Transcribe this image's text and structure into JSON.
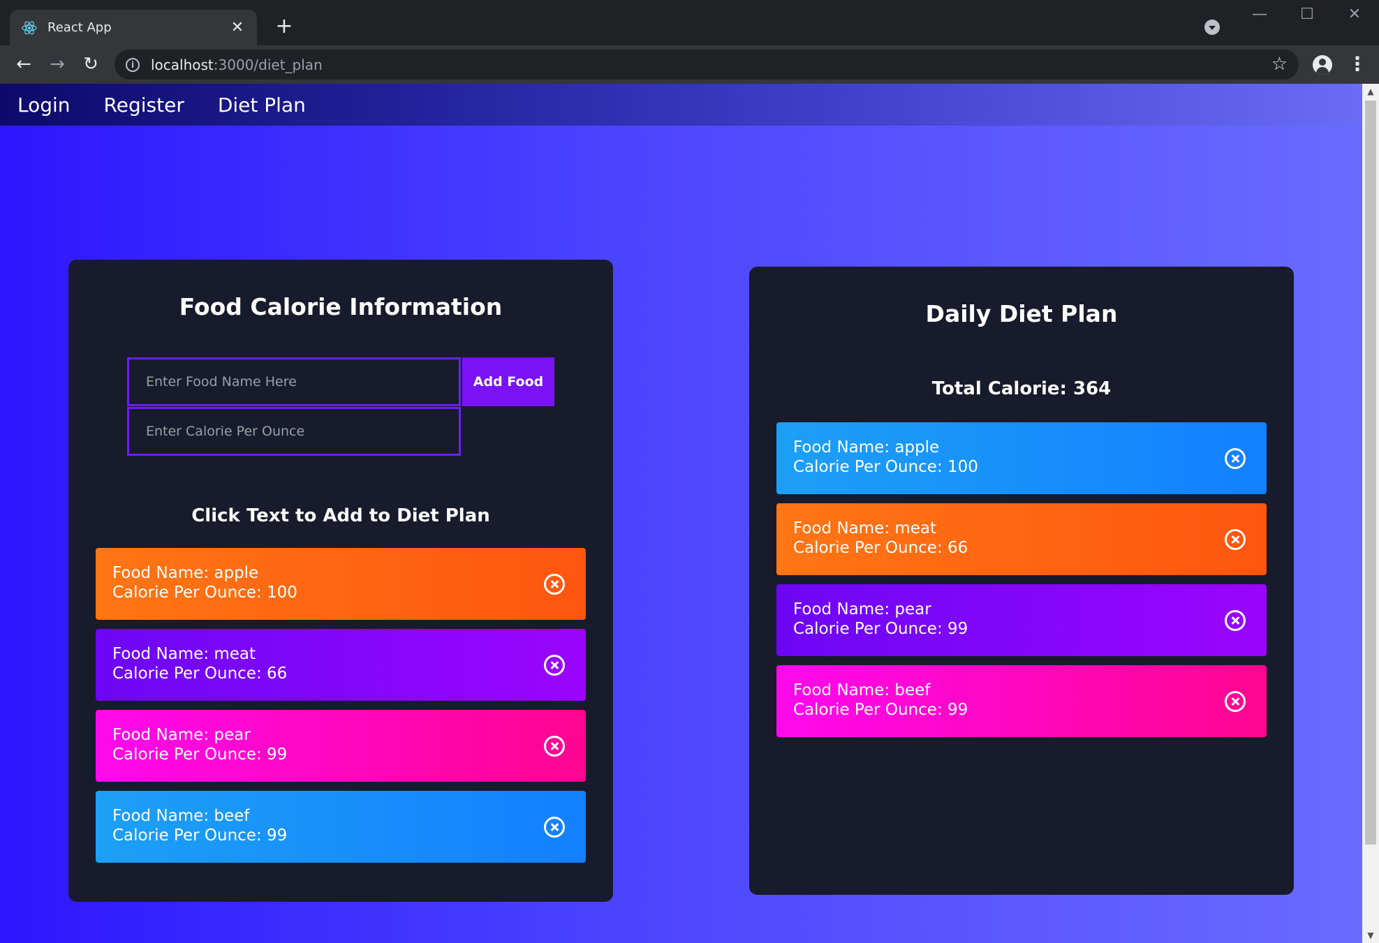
{
  "browser": {
    "tab_title": "React App",
    "tab_close": "✕",
    "new_tab": "+",
    "url_host": "localhost",
    "url_rest": ":3000/diet_plan",
    "win_min": "—",
    "win_max": "☐",
    "win_close": "✕",
    "back": "←",
    "forward": "→",
    "reload": "↻",
    "star": "☆",
    "menu": "⋮"
  },
  "navbar": {
    "links": [
      "Login",
      "Register",
      "Diet Plan"
    ]
  },
  "food_info": {
    "title": "Food Calorie Information",
    "food_name_placeholder": "Enter Food Name Here",
    "calorie_placeholder": "Enter Calorie Per Ounce",
    "add_button": "Add Food",
    "subheading": "Click Text to Add to Diet Plan",
    "items": [
      {
        "name": "Food Name: apple",
        "calorie": "Calorie Per Ounce: 100",
        "color": "orange"
      },
      {
        "name": "Food Name: meat",
        "calorie": "Calorie Per Ounce: 66",
        "color": "purple"
      },
      {
        "name": "Food Name: pear",
        "calorie": "Calorie Per Ounce: 99",
        "color": "pink"
      },
      {
        "name": "Food Name: beef",
        "calorie": "Calorie Per Ounce: 99",
        "color": "blue"
      }
    ]
  },
  "diet_plan": {
    "title": "Daily Diet Plan",
    "total": "Total Calorie: 364",
    "items": [
      {
        "name": "Food Name: apple",
        "calorie": "Calorie Per Ounce: 100",
        "color": "blue"
      },
      {
        "name": "Food Name: meat",
        "calorie": "Calorie Per Ounce: 66",
        "color": "orange"
      },
      {
        "name": "Food Name: pear",
        "calorie": "Calorie Per Ounce: 99",
        "color": "purple"
      },
      {
        "name": "Food Name: beef",
        "calorie": "Calorie Per Ounce: 99",
        "color": "pink"
      }
    ]
  },
  "colors": {
    "orange": "#ff7614",
    "orange_end": "#ff5510",
    "purple": "#6d06f6",
    "purple_end": "#9a05ff",
    "pink": "#ff09ee",
    "pink_end": "#ff0590",
    "blue": "#1ca0f6",
    "blue_end": "#1380ff",
    "card_bg": "#181b2b",
    "input_border": "#6a1ff0",
    "add_button_bg": "#7a12f5"
  }
}
